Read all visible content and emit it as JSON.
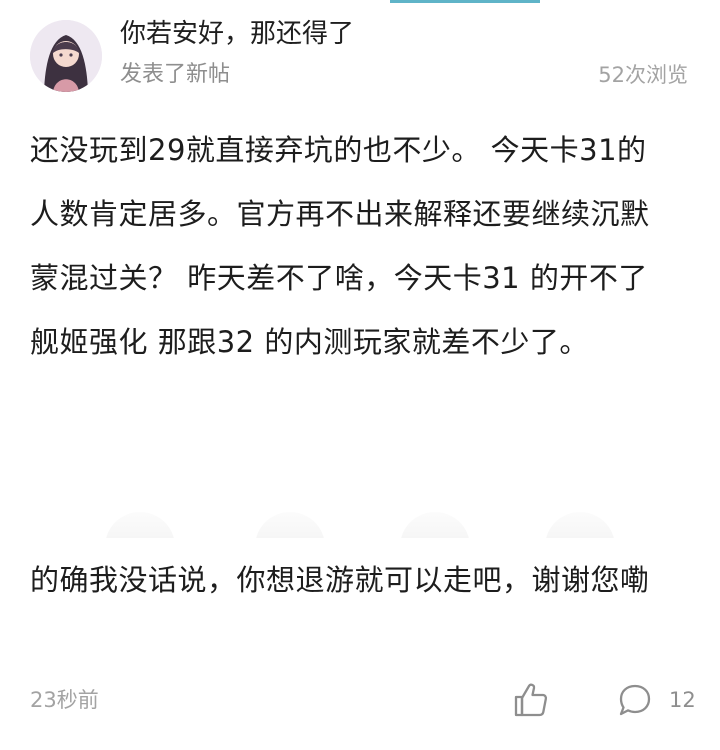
{
  "post": {
    "username": "你若安好，那还得了",
    "action": "发表了新帖",
    "views": "52次浏览",
    "body": "还没玩到29就直接弃坑的也不少。 今天卡31的人数肯定居多。官方再不出来解释还要继续沉默蒙混过关？ 昨天差不了啥，今天卡31 的开不了 舰姬强化 那跟32 的内测玩家就差不少了。"
  },
  "reply": {
    "body": "的确我没话说，你想退游就可以走吧，谢谢您嘞",
    "time": "23秒前",
    "comment_count": "12"
  },
  "icons": {
    "like": "thumbs-up-icon",
    "comment": "comment-bubble-icon"
  },
  "colors": {
    "accent": "#5fb4c8",
    "meta_text": "#a3a3a3",
    "body_text": "#1d1d1d"
  }
}
